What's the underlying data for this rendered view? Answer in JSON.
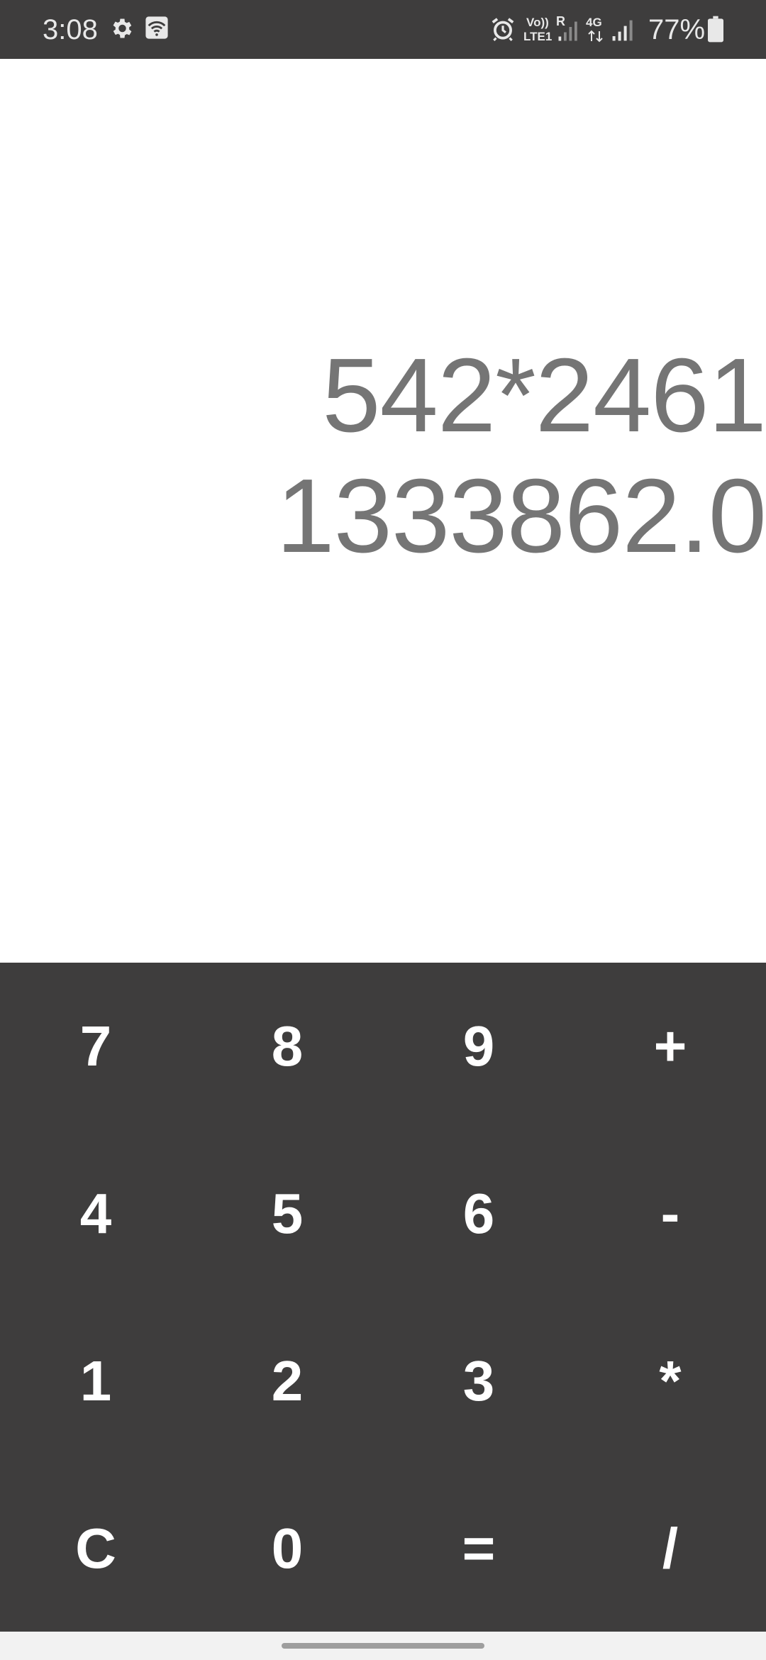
{
  "status_bar": {
    "time": "3:08",
    "battery_percent": "77%",
    "volte_top": "Vo))",
    "volte_bottom": "LTE1",
    "roaming": "R",
    "network": "4G",
    "icons": [
      "gear-icon",
      "wifi-calling-icon",
      "alarm-icon",
      "signal-icon",
      "battery-icon"
    ]
  },
  "display": {
    "expression": "542*2461",
    "result": "1333862.0"
  },
  "keypad": {
    "keys": [
      "7",
      "8",
      "9",
      "+",
      "4",
      "5",
      "6",
      "-",
      "1",
      "2",
      "3",
      "*",
      "C",
      "0",
      "=",
      "/"
    ]
  },
  "colors": {
    "keypad_bg": "#3e3d3d",
    "display_text": "#757575",
    "key_text": "#ffffff"
  }
}
